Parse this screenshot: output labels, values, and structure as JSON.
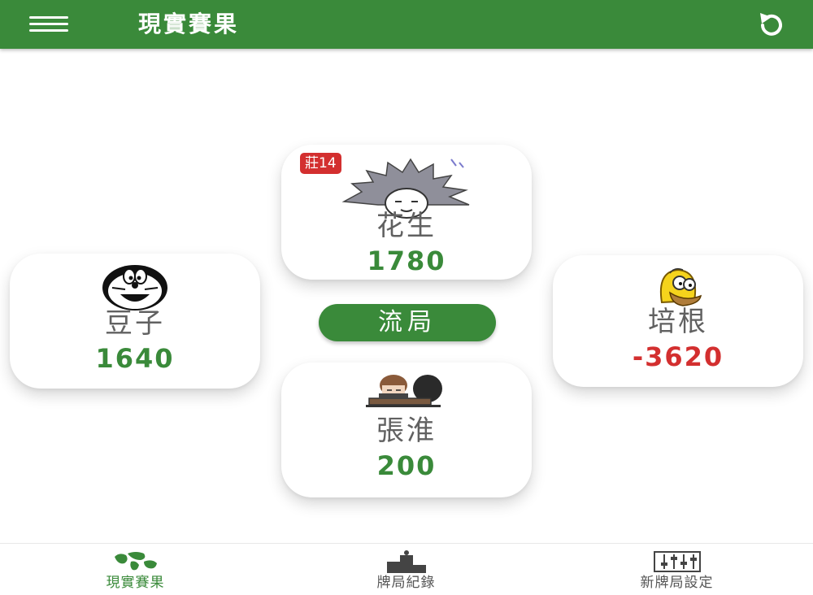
{
  "app_bar": {
    "title": "現實賽果",
    "menu_icon": "hamburger-menu-icon",
    "undo_icon": "undo-icon"
  },
  "players": {
    "top": {
      "name": "花生",
      "score": "1780",
      "score_color": "#3a8a3a",
      "avatar": "spiky-hair-avatar",
      "badge": "莊14"
    },
    "left": {
      "name": "豆子",
      "score": "1640",
      "score_color": "#3a8a3a",
      "avatar": "doraemon-avatar"
    },
    "right": {
      "name": "培根",
      "score": "-3620",
      "score_color": "#d32f2f",
      "avatar": "homer-avatar"
    },
    "bottom": {
      "name": "張淮",
      "score": "200",
      "score_color": "#3a8a3a",
      "avatar": "laptop-person-avatar"
    }
  },
  "draw_button": {
    "label": "流局"
  },
  "bottom_nav": {
    "items": [
      {
        "label": "現實賽果",
        "icon": "world-map-icon",
        "active": true
      },
      {
        "label": "牌局紀錄",
        "icon": "podium-icon",
        "active": false
      },
      {
        "label": "新牌局設定",
        "icon": "sliders-icon",
        "active": false
      }
    ]
  },
  "colors": {
    "primary": "#3a8a3a",
    "negative": "#d32f2f",
    "badge": "#d32f2f"
  }
}
